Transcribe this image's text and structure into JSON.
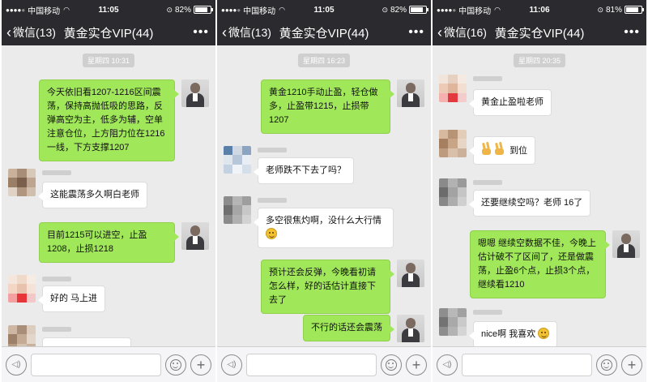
{
  "colors": {
    "bar_bg": "#2b2b2f",
    "chat_bg": "#ebebeb",
    "my_bubble": "#a0e75a",
    "their_bubble": "#ffffff"
  },
  "screens": [
    {
      "status": {
        "carrier": "中国移动",
        "time": "11:05",
        "battery": "82%",
        "battery_level": 0.82
      },
      "nav": {
        "back": "微信(13)",
        "title": "黄金实仓VIP(44)",
        "more": "•••"
      },
      "timestamp": "星期四 10:31",
      "messages": [
        {
          "from": "me",
          "text": "今天依旧看1207-1216区间震荡，保持高抛低吸的思路，反弹高空为主，低多为辅，空单注意仓位，上方阻力位在1216一线，下方支撑1207"
        },
        {
          "from": "other",
          "text": "这能震荡多久啊白老师"
        },
        {
          "from": "me",
          "text": "目前1215可以进空，止盈1208，止损1218"
        },
        {
          "from": "other",
          "text": "好的 马上进"
        },
        {
          "from": "other",
          "text": ""
        }
      ]
    },
    {
      "status": {
        "carrier": "中国移动",
        "time": "11:05",
        "battery": "82%",
        "battery_level": 0.82
      },
      "nav": {
        "back": "微信(13)",
        "title": "黄金实仓VIP(44)",
        "more": "•••"
      },
      "timestamp": "星期四 16:23",
      "messages": [
        {
          "from": "me",
          "text": "黄金1210手动止盈，轻仓做多，止盈带1215，止损带1207"
        },
        {
          "from": "other",
          "text": "老师跌不下去了吗？"
        },
        {
          "from": "other",
          "text": "多空很焦灼啊，没什么大行情",
          "emoji": "worried-face-emoji"
        },
        {
          "from": "me",
          "text": "预计还会反弹，今晚看初请怎么样，好的话估计直接下去了"
        },
        {
          "from": "me",
          "text": "不行的话还会震荡"
        }
      ]
    },
    {
      "status": {
        "carrier": "中国移动",
        "time": "11:06",
        "battery": "81%",
        "battery_level": 0.81
      },
      "nav": {
        "back": "微信(16)",
        "title": "黄金实仓VIP(44)",
        "more": "•••"
      },
      "timestamp": "星期四 20:35",
      "messages": [
        {
          "from": "other",
          "text": "黄金止盈啦老师"
        },
        {
          "from": "other",
          "text": "到位",
          "emoji": "victory-hand-emoji"
        },
        {
          "from": "other",
          "text": "还要继续空吗？老师 16了"
        },
        {
          "from": "me",
          "text": "嗯嗯 继续空数据不佳，今晚上估计破不了区间了，还是做震荡，止盈6个点，止损3个点，继续看1210"
        },
        {
          "from": "other",
          "text": "nice啊 我喜欢",
          "emoji": "grin-face-emoji"
        }
      ]
    }
  ]
}
